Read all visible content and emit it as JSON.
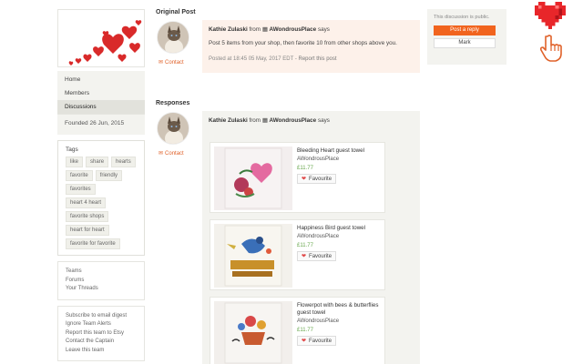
{
  "sidebar": {
    "nav": [
      "Home",
      "Members",
      "Discussions"
    ],
    "founded": "Founded 26 Jun, 2015",
    "tags_title": "Tags",
    "tags": [
      "like",
      "share",
      "hearts",
      "favorite",
      "friendly",
      "favorites",
      "heart 4 heart",
      "favorite shops",
      "heart for heart",
      "favorite for favorite"
    ],
    "links1": [
      "Teams",
      "Forums",
      "Your Threads"
    ],
    "links2": [
      "Subscribe to email digest",
      "Ignore Team Alerts",
      "Report this team to Etsy",
      "Contact the Captain",
      "Leave this team"
    ]
  },
  "original_post": {
    "section_title": "Original Post",
    "author": "Kathie Zulaski",
    "from_word": "from",
    "shop": "AWondrousPlace",
    "says": "says",
    "body": "Post 5 items from your shop, then favorite 10 from other shops above you.",
    "meta": "Posted at 18:45 05 May, 2017 EDT",
    "report": "Report this post",
    "contact": "Contact"
  },
  "responses": {
    "section_title": "Responses",
    "author": "Kathie Zulaski",
    "from_word": "from",
    "shop": "AWondrousPlace",
    "says": "says",
    "contact": "Contact",
    "listings": [
      {
        "title": "Bleeding Heart guest towel",
        "shop": "AWondrousPlace",
        "price": "£11.77",
        "fav": "Favourite"
      },
      {
        "title": "Happiness Bird guest towel",
        "shop": "AWondrousPlace",
        "price": "£11.77",
        "fav": "Favourite"
      },
      {
        "title": "Flowerpot with bees & butterflies guest towel",
        "shop": "AWondrousPlace",
        "price": "£11.77",
        "fav": "Favourite"
      }
    ]
  },
  "right_panel": {
    "public_text": "This discussion is public.",
    "reply": "Post a reply",
    "mark": "Mark"
  },
  "colors": {
    "accent": "#f1641e",
    "price": "#6aa84f",
    "heart": "#e04848"
  }
}
